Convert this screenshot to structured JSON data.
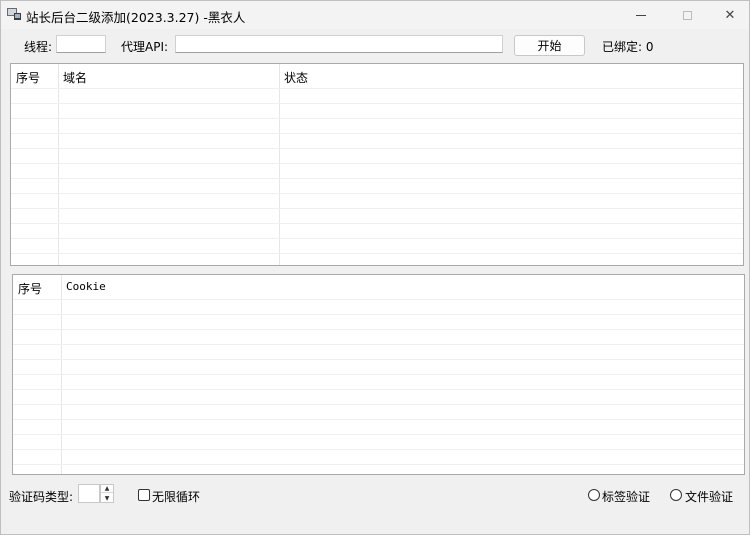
{
  "window": {
    "title": "站长后台二级添加(2023.3.27) -黑衣人",
    "close_glyph": "✕"
  },
  "toolbar": {
    "threads_label": "线程:",
    "threads_value": "",
    "proxy_label": "代理API:",
    "proxy_value": "",
    "start_button": "开始",
    "bound_label": "已绑定:",
    "bound_count": "0"
  },
  "domain_table": {
    "columns": [
      "序号",
      "域名",
      "状态"
    ],
    "rows": []
  },
  "cookie_table": {
    "columns": [
      "序号",
      "Cookie"
    ],
    "rows": []
  },
  "footer": {
    "captcha_type_label": "验证码类型:",
    "captcha_type_value": "",
    "spin_up_glyph": "▲",
    "spin_down_glyph": "▼",
    "infinite_loop_label": "无限循环",
    "infinite_loop_checked": false,
    "tag_verify_label": "标签验证",
    "file_verify_label": "文件验证"
  }
}
